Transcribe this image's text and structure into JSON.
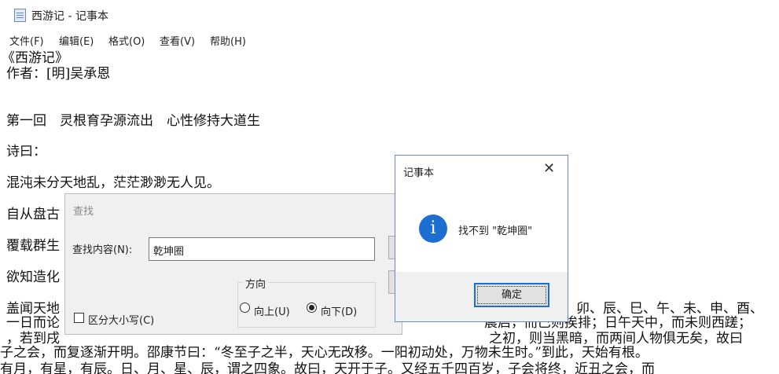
{
  "window": {
    "title": "西游记 - 记事本"
  },
  "menu": [
    "文件(F)",
    "编辑(E)",
    "格式(O)",
    "查看(V)",
    "帮助(H)"
  ],
  "editor": {
    "lines": [
      "《西游记》",
      "作者：[明]吴承恩",
      "",
      "第一回　灵根育孕源流出　心性修持大道生",
      "诗曰：",
      "混沌未分天地乱，茫茫渺渺无人见。",
      "自从盘古",
      "覆载群生",
      "欲知造化",
      "盖闻天地",
      "一日而论",
      "，若到戌",
      "子之会，而复逐渐开明。邵康节曰：“冬至子之半，天心无改移。一阳初动处，万物未生时。”到此，天始有根。",
      "有月，有星，有辰。日、月、星、辰，谓之四象。故曰，天开于子。又经五千四百岁，子会将终，近丑之会，而"
    ],
    "right_fragments": [
      "卯、辰、巳、午、未、申、酉、",
      "晨启，而巳则挨排；日午天中，而未则西蹉；",
      "之初，则当黑暗，而两间人物俱无矣，故曰"
    ]
  },
  "find_dialog": {
    "title": "查找",
    "find_label": "查找内容(N):",
    "find_value": "乾坤圈",
    "direction_label": "方向",
    "up_label": "向上(U)",
    "down_label": "向下(D)",
    "match_case_label": "区分大小写(C)"
  },
  "message_box": {
    "title": "记事本",
    "close_glyph": "✕",
    "icon_glyph": "i",
    "message": "找不到 \"乾坤圈\"",
    "ok_label": "确定"
  }
}
